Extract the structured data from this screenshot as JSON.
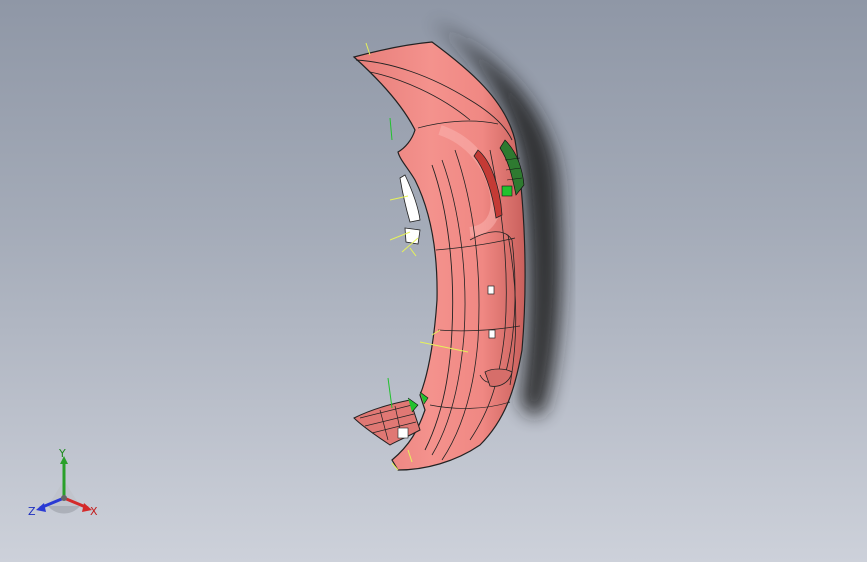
{
  "viewport": {
    "background_top": "#8f97a6",
    "background_bottom": "#cdd1da"
  },
  "model": {
    "part_color": "#f08a86",
    "part_shade": "#c9605c",
    "edge_color": "#222222",
    "feature_color": "#22c12e",
    "construction_line_color": "#e6f25a",
    "shadow_color": "#1a1a1a"
  },
  "triad": {
    "x_label": "X",
    "y_label": "Y",
    "z_label": "Z",
    "x_color": "#d42a2a",
    "y_color": "#2aa02a",
    "z_color": "#2a3ad4"
  }
}
